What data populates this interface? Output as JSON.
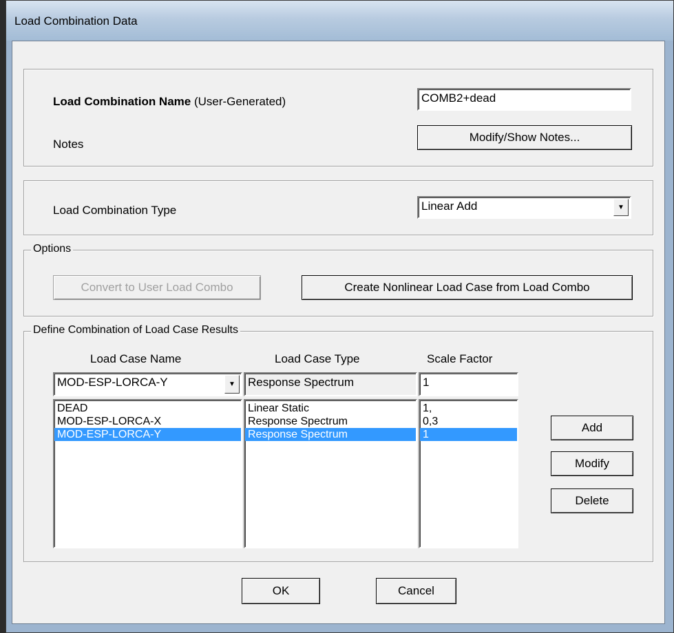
{
  "window": {
    "title": "Load Combination Data"
  },
  "name_section": {
    "name_label_bold": "Load Combination Name",
    "name_label_suffix": " (User-Generated)",
    "name_value": "COMB2+dead",
    "notes_label": "Notes",
    "notes_button": "Modify/Show Notes..."
  },
  "type_section": {
    "type_label": "Load Combination Type",
    "type_value": "Linear Add"
  },
  "options": {
    "legend": "Options",
    "convert_button": "Convert to User Load Combo",
    "create_button": "Create Nonlinear Load Case from Load Combo"
  },
  "define": {
    "legend": "Define Combination of Load Case Results",
    "headers": {
      "name": "Load Case Name",
      "type": "Load Case Type",
      "scale": "Scale Factor"
    },
    "current": {
      "name": "MOD-ESP-LORCA-Y",
      "type": "Response Spectrum",
      "scale": "1"
    },
    "rows": [
      {
        "name": "DEAD",
        "type": "Linear Static",
        "scale": "1,"
      },
      {
        "name": "MOD-ESP-LORCA-X",
        "type": "Response Spectrum",
        "scale": "0,3"
      },
      {
        "name": "MOD-ESP-LORCA-Y",
        "type": "Response Spectrum",
        "scale": "1",
        "selected": true
      }
    ],
    "add_button": "Add",
    "modify_button": "Modify",
    "delete_button": "Delete"
  },
  "footer": {
    "ok_button": "OK",
    "cancel_button": "Cancel"
  }
}
